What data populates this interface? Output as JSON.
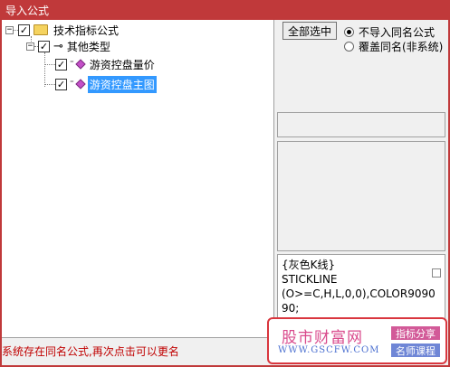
{
  "window": {
    "title": "导入公式"
  },
  "tree": {
    "root": {
      "label": "技术指标公式",
      "checked": true,
      "expanded": true
    },
    "group": {
      "label": "其他类型",
      "checked": true,
      "expanded": true
    },
    "items": [
      {
        "label": "游资控盘量价",
        "checked": true,
        "selected": false
      },
      {
        "label": "游资控盘主图",
        "checked": true,
        "selected": true
      }
    ]
  },
  "controls": {
    "select_all_label": "全部选中",
    "options": [
      {
        "label": "不导入同名公式",
        "selected": true
      },
      {
        "label": "覆盖同名(非系统)",
        "selected": false
      }
    ]
  },
  "preview": {
    "lines": [
      "{灰色K线}",
      "STICKLINE",
      "(O>=C,H,L,0,0),COLOR9090",
      "90;"
    ]
  },
  "status": {
    "message": "系统存在同名公式,再次点击可以更名"
  },
  "watermark": {
    "logo": "股市财富网",
    "url": "WWW.GSCFW.COM",
    "tag1": "指标分享",
    "tag2": "名师课程",
    "colors": {
      "border": "#d9363e",
      "tag1": "#d25a98",
      "tag2": "#6f86d6"
    }
  },
  "colors": {
    "titlebar": "#c0393a",
    "selection": "#3399ff",
    "status_text": "#c00000"
  }
}
